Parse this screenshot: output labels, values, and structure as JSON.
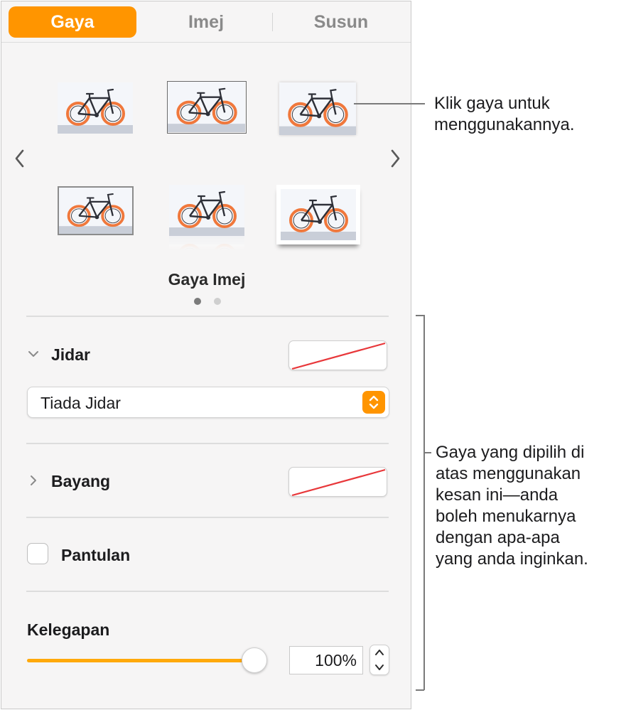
{
  "tabs": [
    {
      "label": "Gaya",
      "active": true
    },
    {
      "label": "Imej",
      "active": false
    },
    {
      "label": "Susun",
      "active": false
    }
  ],
  "image_styles": {
    "caption": "Gaya Imej",
    "page_count": 2,
    "current_page": 1,
    "thumbnail_subject": "bicycle",
    "thumbnails": [
      {
        "frame": "plain"
      },
      {
        "frame": "thin-border",
        "selected": true
      },
      {
        "frame": "soft-edge"
      },
      {
        "frame": "grey-border"
      },
      {
        "frame": "reflection"
      },
      {
        "frame": "curled-shadow"
      }
    ]
  },
  "border": {
    "label": "Jidar",
    "expanded": true,
    "swatch": "none",
    "select_value": "Tiada Jidar"
  },
  "shadow": {
    "label": "Bayang",
    "expanded": false,
    "swatch": "none"
  },
  "reflection": {
    "label": "Pantulan",
    "checked": false
  },
  "opacity": {
    "label": "Kelegapan",
    "value_text": "100%",
    "value": 100
  },
  "callouts": {
    "styles": [
      "Klik gaya untuk",
      "menggunakannya."
    ],
    "effects": [
      "Gaya yang dipilih di",
      "atas menggunakan",
      "kesan ini—anda",
      "boleh menukarnya",
      "dengan apa-apa",
      "yang anda inginkan."
    ]
  },
  "colors": {
    "accent": "#ff9500",
    "slider_fill": "#ffa90a",
    "no_fill_line": "#e8373a",
    "wheel": "#f0783c"
  }
}
